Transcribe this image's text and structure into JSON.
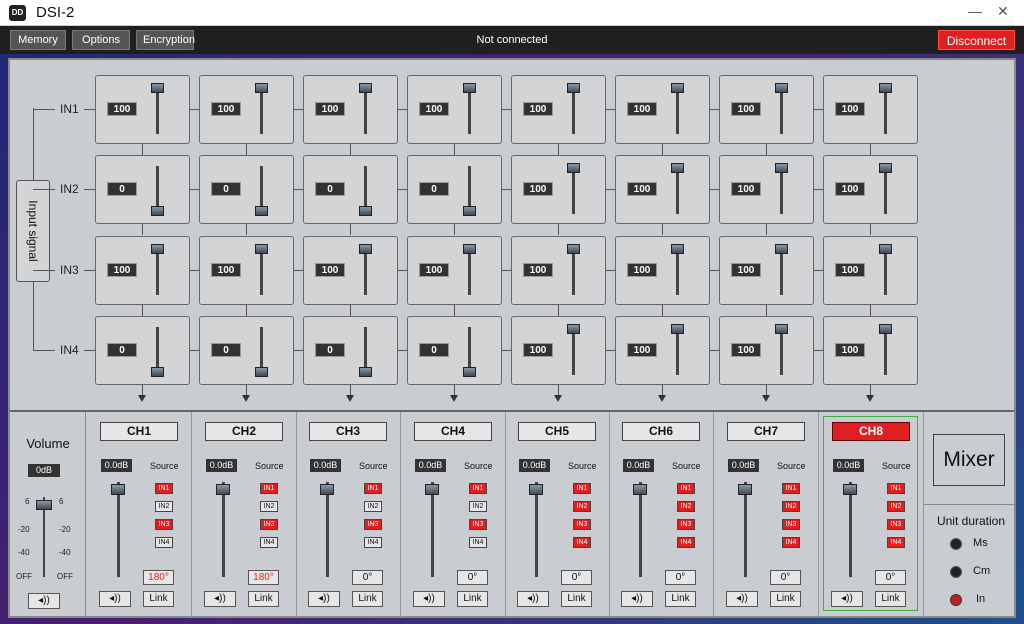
{
  "app": {
    "title": "DSI-2",
    "logo_text": "DD"
  },
  "window": {
    "minimize": "—",
    "close": "✕"
  },
  "menu": {
    "memory": "Memory",
    "options": "Options",
    "encryption": "Encryption",
    "status": "Not connected",
    "disconnect": "Disconnect"
  },
  "matrix": {
    "input_label": "Input signal",
    "rows": [
      {
        "label": "IN1",
        "values": [
          "100",
          "100",
          "100",
          "100",
          "100",
          "100",
          "100",
          "100"
        ]
      },
      {
        "label": "IN2",
        "values": [
          "0",
          "0",
          "0",
          "0",
          "100",
          "100",
          "100",
          "100"
        ]
      },
      {
        "label": "IN3",
        "values": [
          "100",
          "100",
          "100",
          "100",
          "100",
          "100",
          "100",
          "100"
        ]
      },
      {
        "label": "IN4",
        "values": [
          "0",
          "0",
          "0",
          "0",
          "100",
          "100",
          "100",
          "100"
        ]
      }
    ]
  },
  "volume": {
    "title": "Volume",
    "db": "0dB",
    "scale": [
      "6",
      "-20",
      "-40",
      "OFF"
    ],
    "speaker_icon": "◂))"
  },
  "channels": [
    {
      "name": "CH1",
      "db": "0.0dB",
      "source_label": "Source",
      "in": [
        "IN1",
        "IN2",
        "IN3",
        "IN4"
      ],
      "active": [
        true,
        false,
        true,
        false
      ],
      "phase": "180°",
      "link": "Link",
      "speaker": "◂))",
      "selected": false
    },
    {
      "name": "CH2",
      "db": "0.0dB",
      "source_label": "Source",
      "in": [
        "IN1",
        "IN2",
        "IN3",
        "IN4"
      ],
      "active": [
        true,
        false,
        true,
        false
      ],
      "phase": "180°",
      "link": "Link",
      "speaker": "◂))",
      "selected": false
    },
    {
      "name": "CH3",
      "db": "0.0dB",
      "source_label": "Source",
      "in": [
        "IN1",
        "IN2",
        "IN3",
        "IN4"
      ],
      "active": [
        true,
        false,
        true,
        false
      ],
      "phase": "0°",
      "link": "Link",
      "speaker": "◂))",
      "selected": false
    },
    {
      "name": "CH4",
      "db": "0.0dB",
      "source_label": "Source",
      "in": [
        "IN1",
        "IN2",
        "IN3",
        "IN4"
      ],
      "active": [
        true,
        false,
        true,
        false
      ],
      "phase": "0°",
      "link": "Link",
      "speaker": "◂))",
      "selected": false
    },
    {
      "name": "CH5",
      "db": "0.0dB",
      "source_label": "Source",
      "in": [
        "IN1",
        "IN2",
        "IN3",
        "IN4"
      ],
      "active": [
        true,
        true,
        true,
        true
      ],
      "phase": "0°",
      "link": "Link",
      "speaker": "◂))",
      "selected": false
    },
    {
      "name": "CH6",
      "db": "0.0dB",
      "source_label": "Source",
      "in": [
        "IN1",
        "IN2",
        "IN3",
        "IN4"
      ],
      "active": [
        true,
        true,
        true,
        true
      ],
      "phase": "0°",
      "link": "Link",
      "speaker": "◂))",
      "selected": false
    },
    {
      "name": "CH7",
      "db": "0.0dB",
      "source_label": "Source",
      "in": [
        "IN1",
        "IN2",
        "IN3",
        "IN4"
      ],
      "active": [
        true,
        true,
        true,
        true
      ],
      "phase": "0°",
      "link": "Link",
      "speaker": "◂))",
      "selected": false
    },
    {
      "name": "CH8",
      "db": "0.0dB",
      "source_label": "Source",
      "in": [
        "IN1",
        "IN2",
        "IN3",
        "IN4"
      ],
      "active": [
        true,
        true,
        true,
        true
      ],
      "phase": "0°",
      "link": "Link",
      "speaker": "◂))",
      "selected": true
    }
  ],
  "mixer": {
    "label": "Mixer"
  },
  "unit": {
    "title": "Unit duration",
    "options": [
      "Ms",
      "Cm",
      "In"
    ],
    "selected": "In"
  },
  "colors": {
    "active_red": "#e02020",
    "selected_green": "#3cb043"
  }
}
